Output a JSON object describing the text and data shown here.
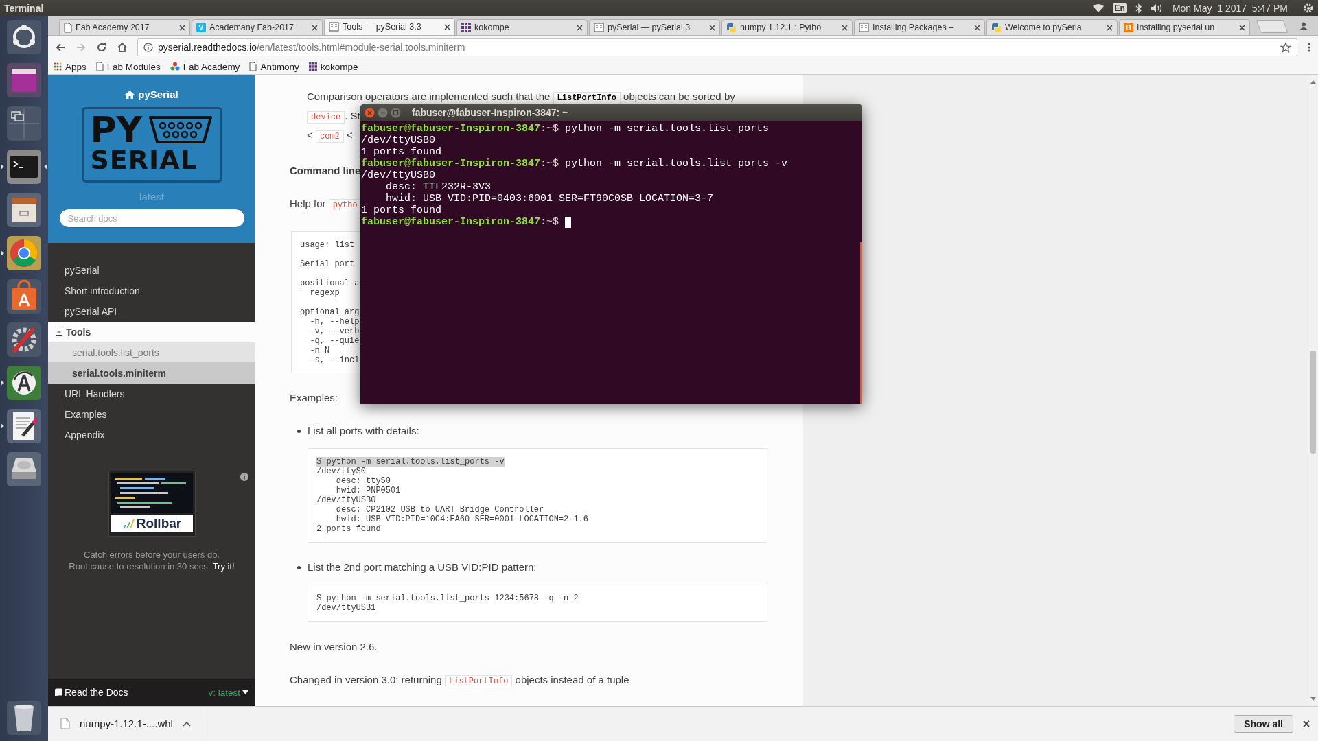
{
  "top_panel": {
    "app_name": "Terminal",
    "keyboard": "En",
    "clock": "Mon May  1 2017  5:47 PM"
  },
  "launcher": [
    {
      "kind": "dash",
      "running": false,
      "focused": false
    },
    {
      "kind": "window",
      "running": false,
      "focused": false
    },
    {
      "kind": "workspaces",
      "running": false,
      "focused": false
    },
    {
      "kind": "terminal",
      "running": true,
      "focused": true
    },
    {
      "kind": "files",
      "running": false,
      "focused": false
    },
    {
      "kind": "browser",
      "running": true,
      "focused": false
    },
    {
      "kind": "store",
      "running": false,
      "focused": false
    },
    {
      "kind": "settings",
      "running": false,
      "focused": false
    },
    {
      "kind": "updater",
      "running": true,
      "focused": false
    },
    {
      "kind": "editor",
      "running": true,
      "focused": false
    },
    {
      "kind": "disk",
      "running": false,
      "focused": false
    }
  ],
  "browser": {
    "tabs": [
      {
        "title": "Fab Academy 2017",
        "kind": "page",
        "selected": false
      },
      {
        "title": "Academany Fab-2017",
        "kind": "letter",
        "glyph": "V",
        "color": "#1ab7ea",
        "selected": false
      },
      {
        "title": "Tools — pySerial 3.3",
        "kind": "docs",
        "selected": true
      },
      {
        "title": "kokompe",
        "kind": "grid",
        "selected": false
      },
      {
        "title": "pySerial — pySerial 3",
        "kind": "docs",
        "selected": false
      },
      {
        "title": "numpy 1.12.1 : Pytho",
        "kind": "python",
        "selected": false
      },
      {
        "title": "Installing Packages –",
        "kind": "docs",
        "selected": false
      },
      {
        "title": "Welcome to pySeria",
        "kind": "python",
        "selected": false
      },
      {
        "title": "Installing pyserial un",
        "kind": "letter",
        "glyph": "B",
        "color": "#f57d00",
        "selected": false
      }
    ],
    "address": {
      "host": "pyserial.readthedocs.io",
      "path": "/en/latest/tools.html#module-serial.tools.miniterm"
    },
    "bookmarks": [
      {
        "label": "Apps",
        "kind": "apps"
      },
      {
        "label": "Fab Modules",
        "kind": "page"
      },
      {
        "label": "Fab Academy",
        "kind": "pinwheel"
      },
      {
        "label": "Antimony",
        "kind": "page"
      },
      {
        "label": "kokompe",
        "kind": "grid"
      }
    ]
  },
  "sidebar": {
    "home": "pySerial",
    "logo": {
      "top": "PY",
      "bottom": "SERIAL"
    },
    "version": "latest",
    "search": {
      "placeholder": "Search docs"
    },
    "nav": [
      {
        "label": "pySerial",
        "selected": false
      },
      {
        "label": "Short introduction",
        "selected": false
      },
      {
        "label": "pySerial API",
        "selected": false
      },
      {
        "label": "Tools",
        "selected": true,
        "children": [
          {
            "label": "serial.tools.list_ports",
            "selected": false
          },
          {
            "label": "serial.tools.miniterm",
            "selected": true
          }
        ]
      },
      {
        "label": "URL Handlers",
        "selected": false
      },
      {
        "label": "Examples",
        "selected": false
      },
      {
        "label": "Appendix",
        "selected": false
      }
    ],
    "ad": {
      "brand": "Rollbar",
      "lines": [
        "Catch errors before your users do.",
        "Root cause to resolution in 30 secs."
      ],
      "link": "Try it!"
    },
    "footer": {
      "label": "Read the Docs",
      "version": "v: latest"
    }
  },
  "doc": {
    "intro_lines": [
      [
        {
          "kind": "text",
          "text": "Comparison operators are implemented such that the "
        },
        {
          "kind": "ref",
          "text": "ListPortInfo"
        },
        {
          "kind": "text",
          "text": " objects can be sorted by"
        }
      ],
      [
        {
          "kind": "code",
          "text": "device"
        },
        {
          "kind": "text",
          "text": ". St"
        }
      ],
      [
        {
          "kind": "text",
          "text": "< "
        },
        {
          "kind": "code",
          "text": "com2"
        },
        {
          "kind": "text",
          "text": " <"
        }
      ]
    ],
    "heading": "Command line",
    "help": [
      {
        "kind": "text",
        "text": "Help for "
      },
      {
        "kind": "code",
        "text": "pytho"
      }
    ],
    "usage_block": [
      [
        "usage: list_"
      ],
      [
        "Serial port"
      ],
      [
        "positional a",
        "  regexp"
      ],
      [
        "optional arg",
        "  -h, --help",
        "  -v, --verb",
        "  -q, --quie",
        "  -n N",
        "  -s, --incl"
      ]
    ],
    "examples_label": "Examples:",
    "examples": [
      {
        "caption": "List all ports with details:",
        "code": [
          {
            "text": "$ python -m serial.tools.list_ports -v",
            "selected": true
          },
          {
            "text": "/dev/ttyS0",
            "selected": false
          },
          {
            "text": "    desc: ttyS0",
            "selected": false
          },
          {
            "text": "    hwid: PNP0501",
            "selected": false
          },
          {
            "text": "/dev/ttyUSB0",
            "selected": false
          },
          {
            "text": "    desc: CP2102 USB to UART Bridge Controller",
            "selected": false
          },
          {
            "text": "    hwid: USB VID:PID=10C4:EA60 SER=0001 LOCATION=2-1.6",
            "selected": false
          },
          {
            "text": "2 ports found",
            "selected": false
          }
        ]
      },
      {
        "caption": "List the 2nd port matching a USB VID:PID pattern:",
        "code": [
          {
            "text": "$ python -m serial.tools.list_ports 1234:5678 -q -n 2",
            "selected": false
          },
          {
            "text": "/dev/ttyUSB1",
            "selected": false
          }
        ]
      }
    ],
    "notes": [
      [
        {
          "kind": "text",
          "text": "New in version 2.6."
        }
      ],
      [
        {
          "kind": "text",
          "text": "Changed in version 3.0: returning "
        },
        {
          "kind": "code",
          "text": "ListPortInfo"
        },
        {
          "kind": "text",
          "text": " objects instead of a tuple"
        }
      ]
    ]
  },
  "terminal": {
    "title": "fabuser@fabuser-Inspiron-3847: ~",
    "lines": [
      {
        "kind": "prompt",
        "user": "fabuser@fabuser-Inspiron-3847",
        "dir": ":~$",
        "command": " python -m serial.tools.list_ports",
        "cursor": false
      },
      {
        "kind": "output",
        "text": "/dev/ttyUSB0",
        "cursor": false
      },
      {
        "kind": "output",
        "text": "1 ports found",
        "cursor": false
      },
      {
        "kind": "prompt",
        "user": "fabuser@fabuser-Inspiron-3847",
        "dir": ":~$",
        "command": " python -m serial.tools.list_ports -v",
        "cursor": false
      },
      {
        "kind": "output",
        "text": "/dev/ttyUSB0",
        "cursor": false
      },
      {
        "kind": "output",
        "text": "    desc: TTL232R-3V3",
        "cursor": false
      },
      {
        "kind": "output",
        "text": "    hwid: USB VID:PID=0403:6001 SER=FT90C0SB LOCATION=3-7",
        "cursor": false
      },
      {
        "kind": "output",
        "text": "1 ports found",
        "cursor": false
      },
      {
        "kind": "prompt",
        "user": "fabuser@fabuser-Inspiron-3847",
        "dir": ":~$",
        "cursor": true
      }
    ]
  },
  "downloads": {
    "file": "numpy-1.12.1-....whl",
    "show_all": "Show all"
  }
}
